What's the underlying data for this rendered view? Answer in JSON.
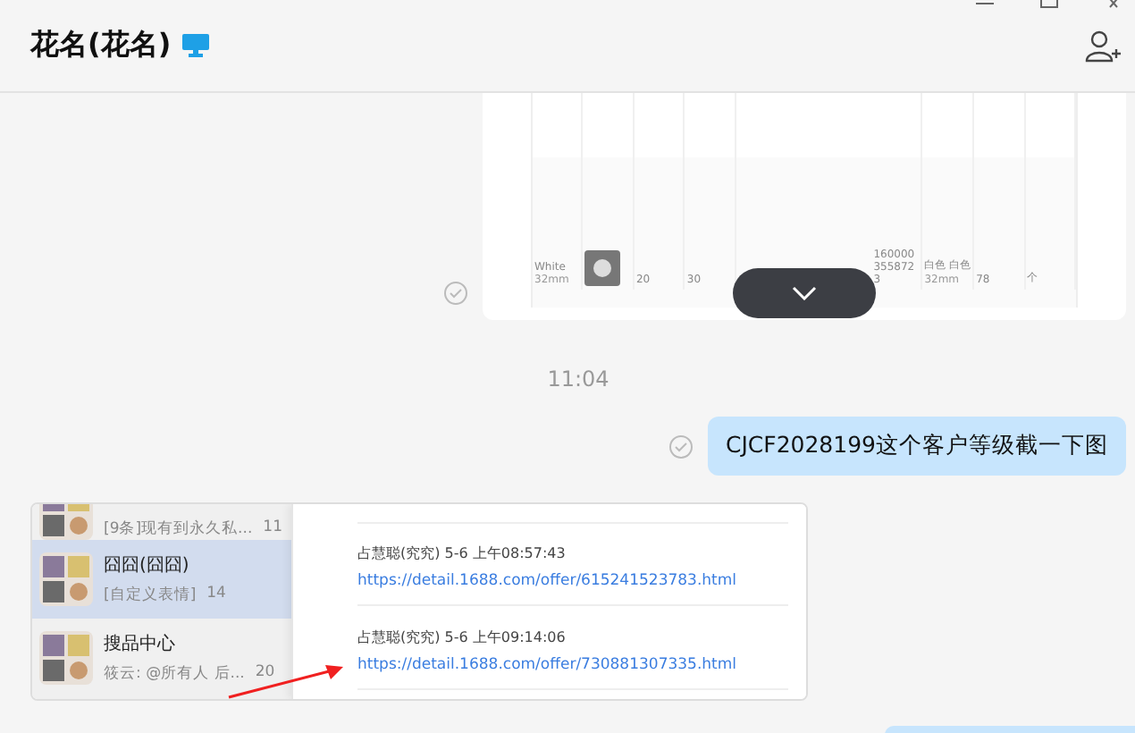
{
  "window": {
    "title": "花名(花名)"
  },
  "messages": [
    {
      "kind": "table_shot",
      "cells": [
        "White",
        "32mm",
        "20",
        "30",
        "160000",
        "355872",
        "3",
        "白色 白色",
        "32mm",
        "78",
        "个"
      ]
    },
    {
      "kind": "time",
      "text": "11:04"
    },
    {
      "kind": "text",
      "text": "CJCF2028199这个客户等级截一下图"
    },
    {
      "kind": "chat_shot",
      "list": [
        {
          "preview": "[9条]现有到永久私...",
          "time": "11",
          "selected": false
        },
        {
          "name": "囧囧(囧囧)",
          "preview": "[自定义表情]",
          "time": "14",
          "selected": true
        },
        {
          "name": "搜品中心",
          "preview": "筱云: @所有人  后...",
          "time": "20",
          "selected": false
        }
      ],
      "records": [
        {
          "sender": "占慧聪(究究) 5-6 上午08:57:43",
          "link": "https://detail.1688.com/offer/615241523783.html"
        },
        {
          "sender": "占慧聪(究究) 5-6 上午09:14:06",
          "link": "https://detail.1688.com/offer/730881307335.html"
        }
      ]
    },
    {
      "kind": "bubble_edge"
    }
  ]
}
